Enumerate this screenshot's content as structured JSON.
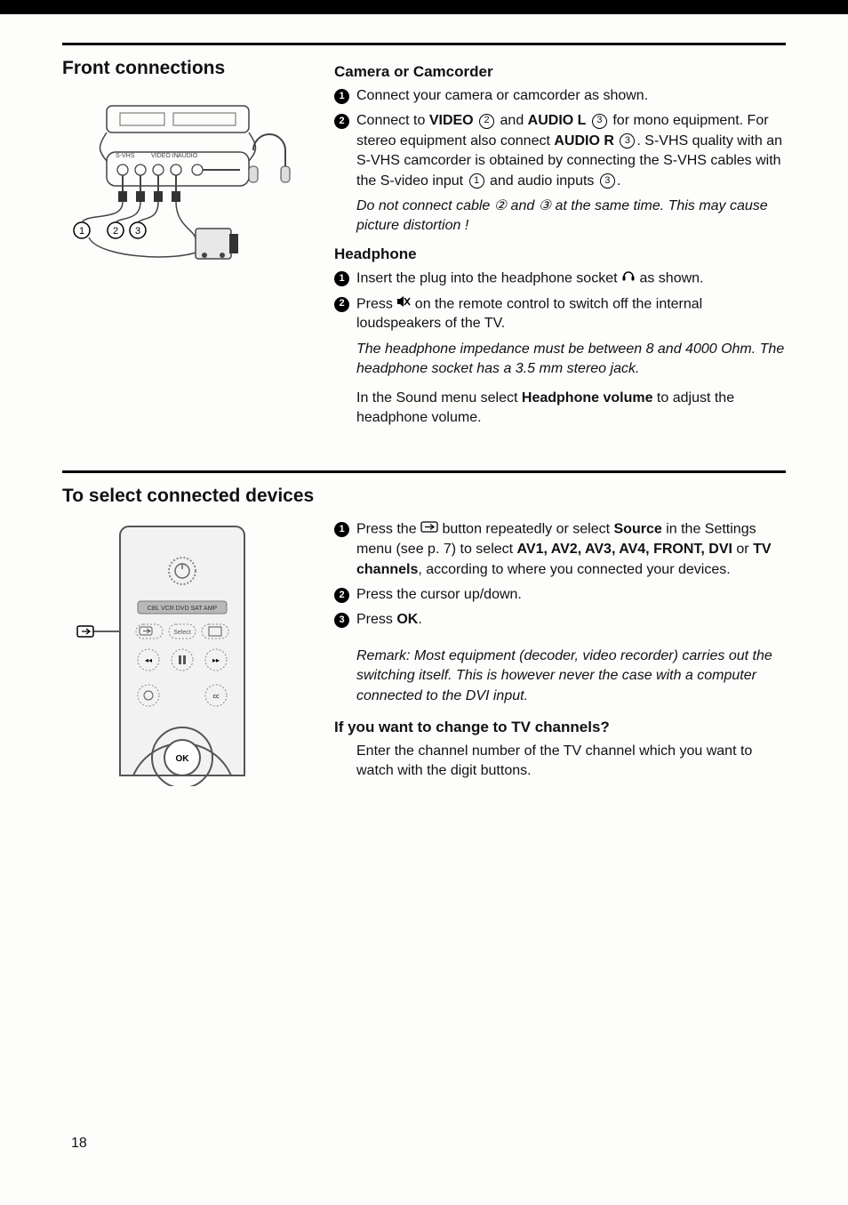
{
  "page_number": "18",
  "section1": {
    "heading": "Front connections",
    "sub1": {
      "title": "Camera or Camcorder",
      "step1": "Connect your camera or camcorder as shown.",
      "step2_a": "Connect to ",
      "step2_b": "VIDEO",
      "step2_c": " and ",
      "step2_d": "AUDIO L",
      "step2_e": " for mono equipment. For stereo equipment also connect ",
      "step2_f": "AUDIO R",
      "step2_g": ". S-VHS quality with an S-VHS camcorder is obtained by connecting the S-VHS cables with the S-video input ",
      "step2_h": " and audio inputs ",
      "step2_i": ".",
      "note": "Do not connect cable ② and ③ at the same time. This may cause picture distortion !"
    },
    "sub2": {
      "title": "Headphone",
      "step1_a": "Insert the plug into the headphone socket ",
      "step1_b": " as shown.",
      "step2_a": "Press ",
      "step2_b": " on the remote control to switch off the internal loudspeakers of the TV.",
      "note": "The headphone impedance must be between 8 and 4000 Ohm. The headphone socket has a 3.5 mm stereo jack.",
      "tail_a": "In the Sound menu select ",
      "tail_b": "Headphone volume",
      "tail_c": " to adjust the headphone volume."
    }
  },
  "section2": {
    "heading": "To select connected devices",
    "step1_a": "Press the ",
    "step1_b": " button repeatedly or select ",
    "step1_c": "Source",
    "step1_d": " in the Settings menu (see p. 7) to select ",
    "step1_e": "AV1, AV2, AV3, AV4, FRONT, DVI",
    "step1_f": " or ",
    "step1_g": "TV channels",
    "step1_h": ", according to where you connected your devices.",
    "step2": "Press the cursor up/down.",
    "step3_a": "Press ",
    "step3_b": "OK",
    "step3_c": ".",
    "remark": "Remark: Most equipment (decoder, video recorder) carries out the switching itself. This is however never the case with a computer connected to the DVI input.",
    "q_title": "If you want to change to TV channels?",
    "q_body": "Enter the channel number of the TV channel which you want to watch with the digit buttons."
  },
  "remote_labels": "CBL VCR DVD SAT AMP",
  "remote_ok": "OK"
}
